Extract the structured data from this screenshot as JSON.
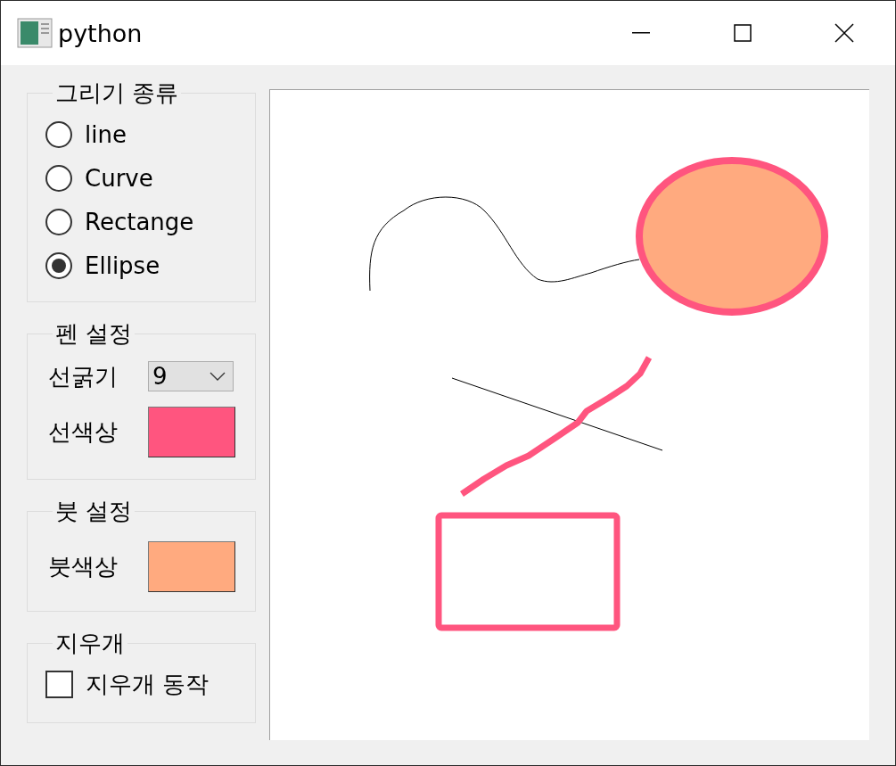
{
  "window": {
    "title": "python"
  },
  "draw_type": {
    "title": "그리기 종류",
    "options": [
      {
        "label": "line",
        "selected": false
      },
      {
        "label": "Curve",
        "selected": false
      },
      {
        "label": "Rectange",
        "selected": false
      },
      {
        "label": "Ellipse",
        "selected": true
      }
    ]
  },
  "pen": {
    "title": "펜 설정",
    "width_label": "선굵기",
    "width_value": "9",
    "color_label": "선색상",
    "color": "#ff557f"
  },
  "brush": {
    "title": "붓 설정",
    "color_label": "붓색상",
    "color": "#ffaa7f"
  },
  "eraser": {
    "title": "지우개",
    "checkbox": {
      "label": "지우개 동작",
      "checked": false
    }
  }
}
